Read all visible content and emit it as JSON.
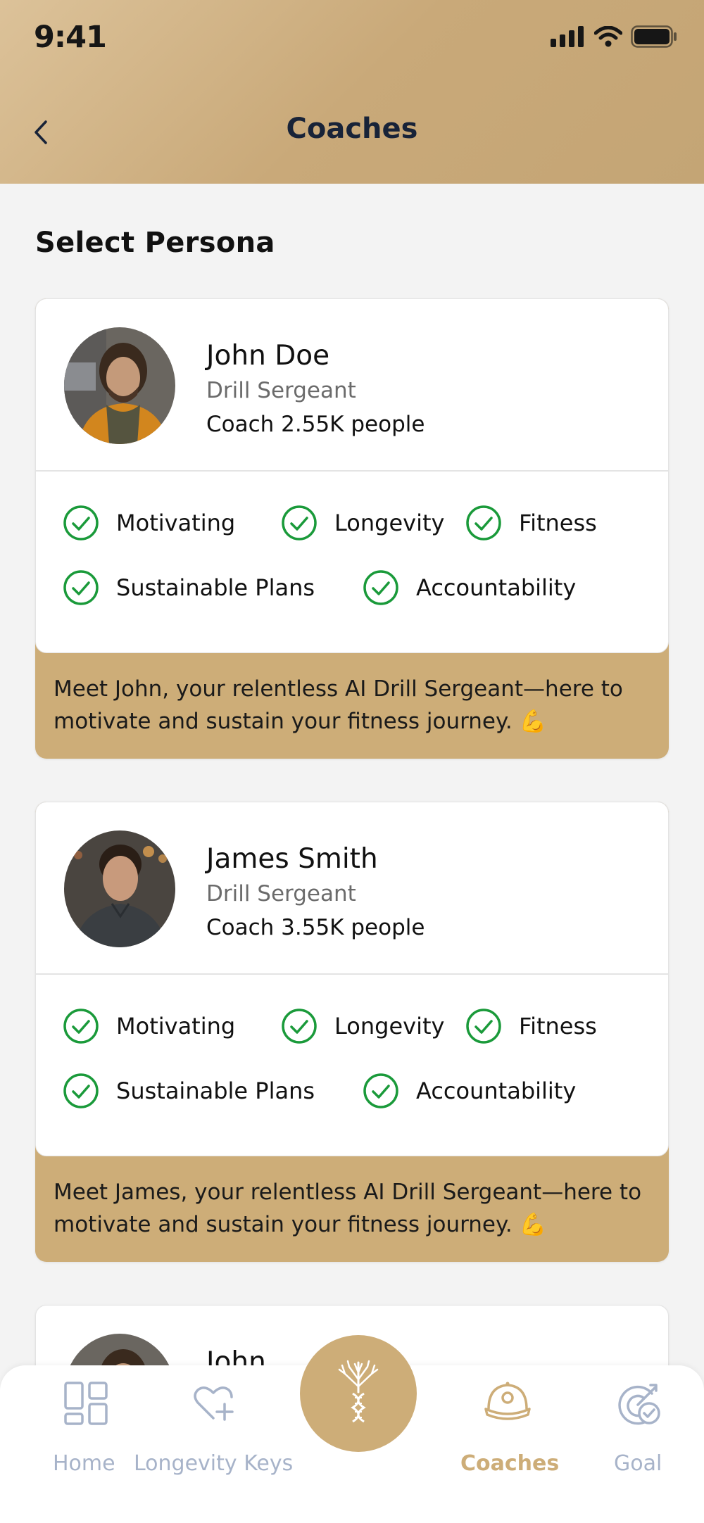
{
  "status_bar": {
    "time": "9:41"
  },
  "header": {
    "title": "Coaches",
    "back_icon": "chevron-left-icon"
  },
  "section": {
    "title": "Select Persona"
  },
  "coaches": [
    {
      "name": "John Doe",
      "role": "Drill Sergeant",
      "count": "Coach 2.55K people",
      "tags": [
        "Motivating",
        "Longevity",
        "Fitness",
        "Sustainable Plans",
        "Accountability"
      ],
      "description": "Meet John, your relentless AI Drill Sergeant—here to motivate and sustain your fitness journey. 💪"
    },
    {
      "name": "James Smith",
      "role": "Drill Sergeant",
      "count": "Coach 3.55K people",
      "tags": [
        "Motivating",
        "Longevity",
        "Fitness",
        "Sustainable Plans",
        "Accountability"
      ],
      "description": "Meet James, your relentless AI Drill Sergeant—here to motivate and sustain your fitness journey. 💪"
    },
    {
      "name": "John"
    }
  ],
  "nav": {
    "items": [
      {
        "label": "Home",
        "icon": "home-grid-icon"
      },
      {
        "label": "Longevity Keys",
        "icon": "heart-plus-icon"
      },
      {
        "label": "",
        "icon": "dna-tree-icon"
      },
      {
        "label": "Coaches",
        "icon": "coach-cap-icon"
      },
      {
        "label": "Goal",
        "icon": "goal-target-icon"
      }
    ],
    "active": "Coaches"
  },
  "colors": {
    "accent": "#cdad78",
    "check": "#1a9a3a",
    "title": "#182338",
    "nav_inactive": "#a7b3c9"
  }
}
